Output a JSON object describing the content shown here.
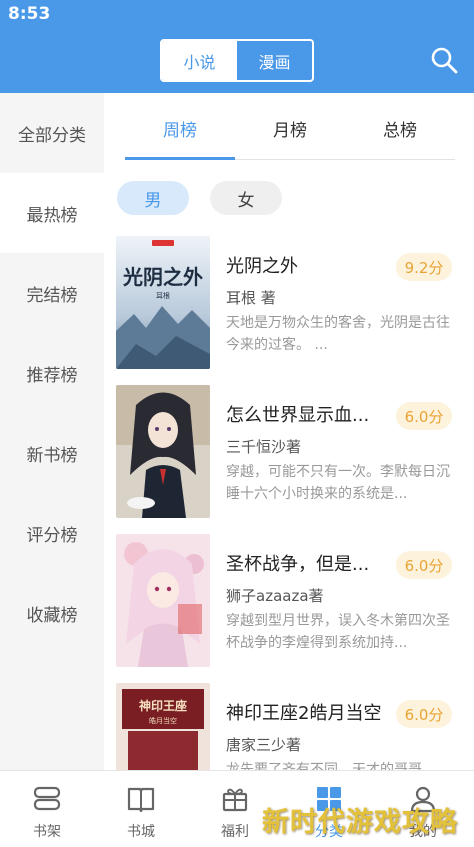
{
  "status_bar": {
    "time": "8:53"
  },
  "header": {
    "segments": [
      {
        "label": "小说",
        "active": true
      },
      {
        "label": "漫画",
        "active": false
      }
    ],
    "search_icon": "search-icon"
  },
  "sidebar": {
    "items": [
      {
        "label": "全部分类",
        "active": false
      },
      {
        "label": "最热榜",
        "active": true
      },
      {
        "label": "完结榜",
        "active": false
      },
      {
        "label": "推荐榜",
        "active": false
      },
      {
        "label": "新书榜",
        "active": false
      },
      {
        "label": "评分榜",
        "active": false
      },
      {
        "label": "收藏榜",
        "active": false
      }
    ]
  },
  "tabs": [
    {
      "label": "周榜",
      "active": true
    },
    {
      "label": "月榜",
      "active": false
    },
    {
      "label": "总榜",
      "active": false
    }
  ],
  "gender": [
    {
      "label": "男",
      "active": true
    },
    {
      "label": "女",
      "active": false
    }
  ],
  "books": [
    {
      "title": "光阴之外",
      "score": "9.2分",
      "author": "耳根 著",
      "desc": "天地是万物众生的客舍，光阴是古往今来的过客。 ..."
    },
    {
      "title": "怎么世界显示血...",
      "score": "6.0分",
      "author": "三千恒沙著",
      "desc": "穿越，可能不只有一次。李默每日沉睡十六个小时换来的系统是..."
    },
    {
      "title": "圣杯战争，但是...",
      "score": "6.0分",
      "author": "狮子azaaza著",
      "desc": "穿越到型月世界，误入冬木第四次圣杯战争的李煌得到系统加持..."
    },
    {
      "title": "神印王座2皓月当空",
      "score": "6.0分",
      "author": "唐家三少著",
      "desc": "龙先要了齐有不同，天才的哥哥"
    }
  ],
  "cover_text": {
    "book1_title": "光阴之外",
    "book1_author": "耳根",
    "book4_title": "神印王座",
    "book4_sub": "皓月当空"
  },
  "bottom_nav": [
    {
      "label": "书架",
      "icon": "bookshelf-icon",
      "active": false
    },
    {
      "label": "书城",
      "icon": "book-open-icon",
      "active": false
    },
    {
      "label": "福利",
      "icon": "gift-icon",
      "active": false
    },
    {
      "label": "分类",
      "icon": "grid-icon",
      "active": true
    },
    {
      "label": "我的",
      "icon": "user-icon",
      "active": false
    }
  ],
  "watermark": "新时代游戏攻略",
  "colors": {
    "accent": "#4a98e8",
    "score": "#e9a437",
    "score_bg": "#fdf3dc",
    "watermark": "#e3c23a"
  }
}
